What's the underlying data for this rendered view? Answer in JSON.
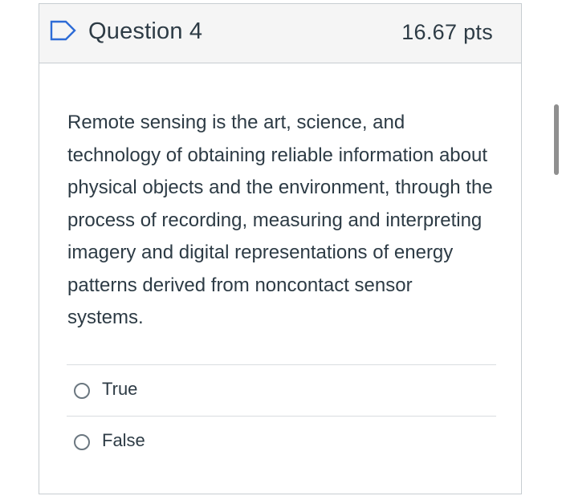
{
  "question": {
    "title": "Question 4",
    "points": "16.67 pts",
    "flag_icon": "flag-outline-icon",
    "text": "Remote sensing is the art, science, and technology of obtaining reliable information about physical objects and the environment, through the process of recording, measuring and interpreting imagery and digital representations of energy patterns derived from noncontact sensor systems."
  },
  "answers": [
    {
      "label": "True",
      "selected": false
    },
    {
      "label": "False",
      "selected": false
    }
  ],
  "colors": {
    "text": "#2d3b45",
    "header_bg": "#f5f5f5",
    "border": "#c7cdd1",
    "accent": "#2d6bd6"
  }
}
